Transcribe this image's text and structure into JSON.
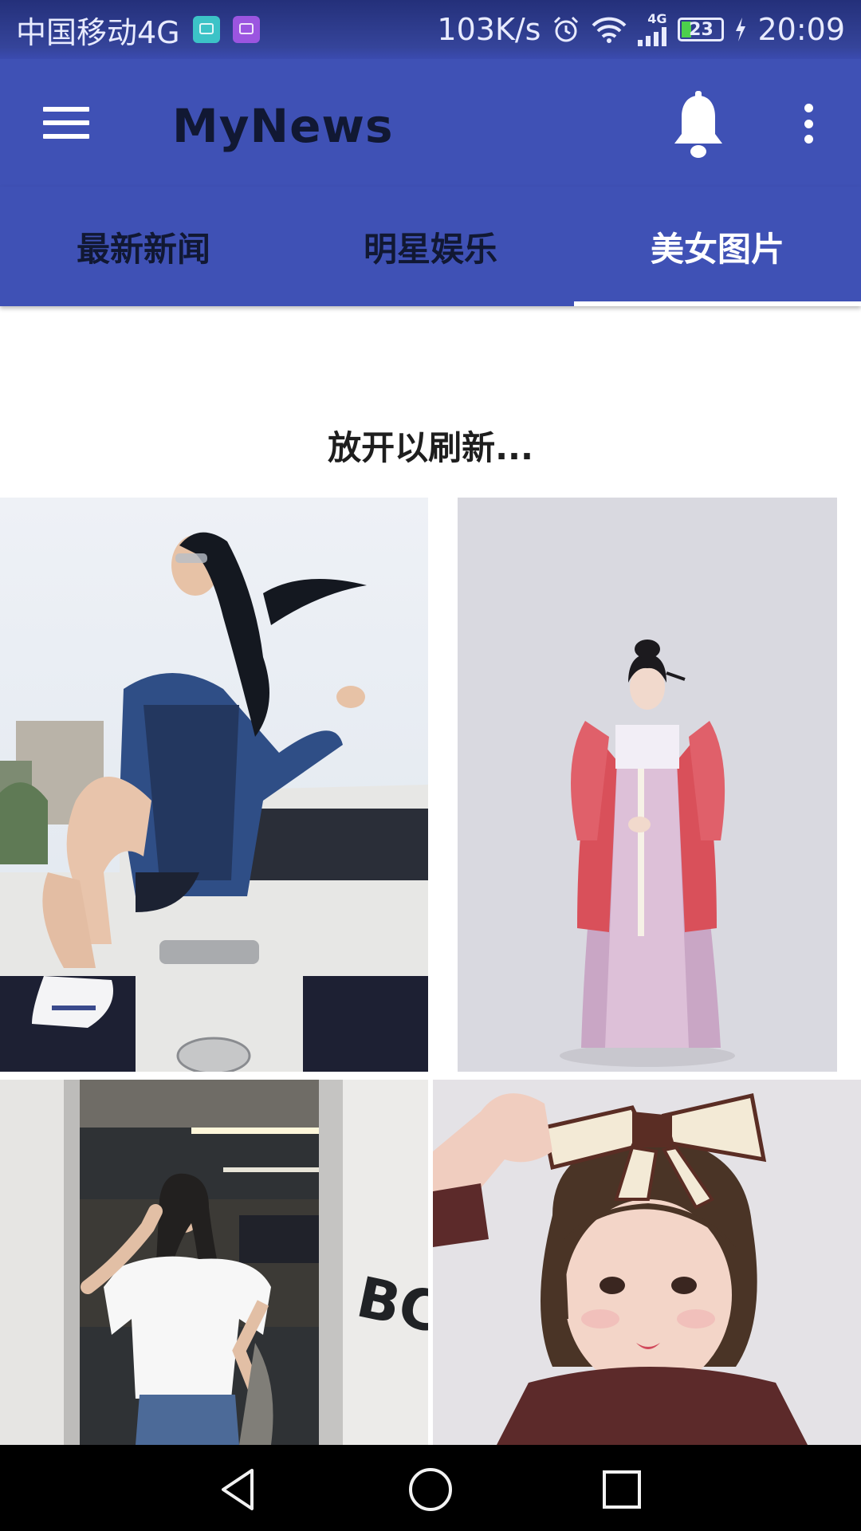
{
  "status_bar": {
    "carrier": "中国移动4G",
    "speed": "103K/s",
    "network_type": "4G",
    "battery_level": "23",
    "time": "20:09",
    "icons": [
      "android-notification-icon",
      "gallery-notification-icon",
      "alarm-icon",
      "wifi-icon",
      "signal-icon",
      "battery-icon",
      "charging-icon"
    ]
  },
  "app_bar": {
    "title": "MyNews",
    "icons": [
      "menu-icon",
      "bell-icon",
      "more-vert-icon"
    ]
  },
  "tabs": [
    {
      "label": "最新新闻",
      "active": false
    },
    {
      "label": "明星娱乐",
      "active": false
    },
    {
      "label": "美女图片",
      "active": true
    }
  ],
  "refresh_hint": "放开以刷新...",
  "photos": [
    {
      "subject": "woman in denim jacket sitting on white truck"
    },
    {
      "subject": "woman in traditional hanfu dress"
    },
    {
      "subject": "woman in white t-shirt in parking garage"
    },
    {
      "subject": "girl with bob haircut and bow headband"
    }
  ],
  "nav_bar": {
    "icons": [
      "back-icon",
      "home-icon",
      "recent-apps-icon"
    ]
  },
  "colors": {
    "primary": "#3f51b5",
    "status_bar": "#2c3a8c",
    "tab_active_text": "#ffffff",
    "tab_text": "#111833",
    "indicator": "#ffffff"
  }
}
